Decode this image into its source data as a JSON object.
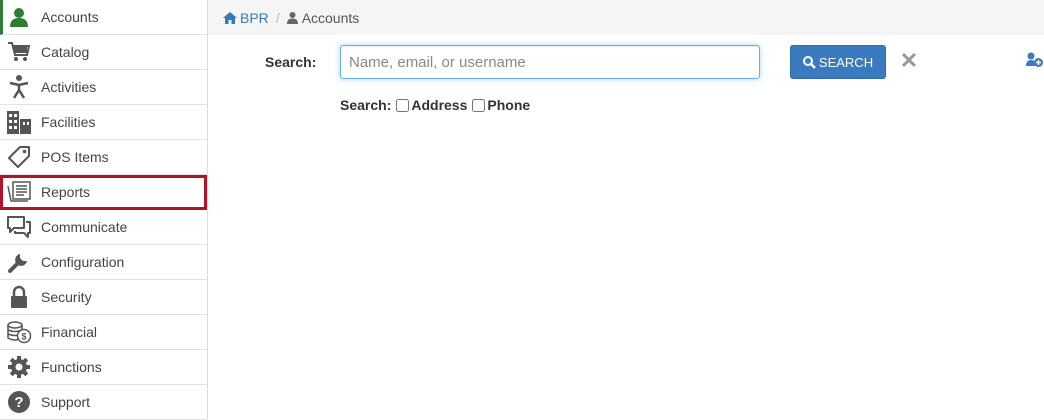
{
  "sidebar": {
    "items": [
      {
        "label": "Accounts",
        "icon": "user-icon"
      },
      {
        "label": "Catalog",
        "icon": "cart-icon"
      },
      {
        "label": "Activities",
        "icon": "person-activity-icon"
      },
      {
        "label": "Facilities",
        "icon": "building-icon"
      },
      {
        "label": "POS Items",
        "icon": "tag-icon"
      },
      {
        "label": "Reports",
        "icon": "reports-icon"
      },
      {
        "label": "Communicate",
        "icon": "chat-icon"
      },
      {
        "label": "Configuration",
        "icon": "wrench-icon"
      },
      {
        "label": "Security",
        "icon": "lock-icon"
      },
      {
        "label": "Financial",
        "icon": "coins-icon"
      },
      {
        "label": "Functions",
        "icon": "gear-icon"
      },
      {
        "label": "Support",
        "icon": "question-icon"
      }
    ],
    "active": "Accounts",
    "highlighted": "Reports"
  },
  "breadcrumb": {
    "home": "BPR",
    "separator": "/",
    "current": "Accounts"
  },
  "search": {
    "label": "Search:",
    "placeholder": "Name, email, or username",
    "value": "",
    "button_label": "SEARCH",
    "clear_icon": "close-icon",
    "add_icon": "add-user-icon"
  },
  "options": {
    "label": "Search:",
    "address_label": "Address",
    "address_checked": false,
    "phone_label": "Phone",
    "phone_checked": false
  },
  "colors": {
    "accent": "#3a7bbf",
    "active_icon": "#2e7d32",
    "highlight": "#b0142a",
    "link": "#337ab7"
  }
}
